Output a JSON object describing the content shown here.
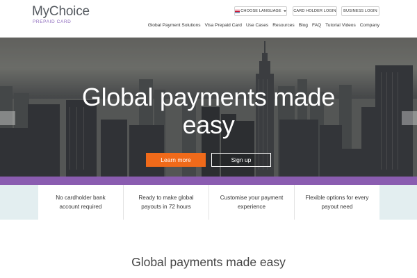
{
  "brand": {
    "name": "MyChoice",
    "tagline": "PREPAID CARD"
  },
  "top_buttons": {
    "language": "CHOOSE LANGUAGE",
    "card_holder": "CARD HOLDER LOGIN",
    "business": "BUSINESS LOGIN"
  },
  "nav": [
    "Global Payment Solutions",
    "Visa Prepaid Card",
    "Use Cases",
    "Resources",
    "Blog",
    "FAQ",
    "Tutorial Videos",
    "Company"
  ],
  "hero": {
    "title": "Global payments made easy",
    "learn_more": "Learn more",
    "sign_up": "Sign up"
  },
  "features": [
    "No cardholder bank account required",
    "Ready to make global payouts in 72 hours",
    "Customise your payment experience",
    "Flexible options for every payout need"
  ],
  "section": {
    "title": "Global payments made easy"
  },
  "colors": {
    "accent_orange": "#f06a1a",
    "brand_purple": "#8a5cb0",
    "features_bg": "#e3eef0"
  },
  "icons": {
    "prev": "arrow-left-icon",
    "next": "arrow-right-icon",
    "flag": "uk-flag-icon",
    "caret": "chevron-down-icon"
  }
}
